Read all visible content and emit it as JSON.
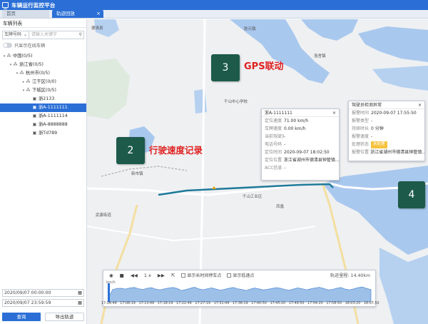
{
  "app": {
    "title": "车辆运行监控平台"
  },
  "tabs": [
    {
      "label": "首页"
    },
    {
      "label": "轨迹回放",
      "close": "×"
    }
  ],
  "sidebar": {
    "title": "车辆列表",
    "select_value": "车牌号码",
    "search_placeholder": "请输入关键字",
    "toggle_label": "只显示在线车辆",
    "tree": [
      {
        "label": "中国(0/5)",
        "level": 0,
        "type": "org",
        "expanded": true
      },
      {
        "label": "浙江省(0/5)",
        "level": 1,
        "type": "org",
        "expanded": true
      },
      {
        "label": "杭州市(0/5)",
        "level": 2,
        "type": "org",
        "expanded": true
      },
      {
        "label": "江干区(0/0)",
        "level": 3,
        "type": "org",
        "expanded": false
      },
      {
        "label": "下城区(0/5)",
        "level": 3,
        "type": "org",
        "expanded": true
      },
      {
        "label": "浙2133",
        "level": 4,
        "type": "car"
      },
      {
        "label": "浙A-1111111",
        "level": 4,
        "type": "car",
        "selected": true
      },
      {
        "label": "浙A-1111114",
        "level": 4,
        "type": "car"
      },
      {
        "label": "浙A-8888888",
        "level": 4,
        "type": "car"
      },
      {
        "label": "浙Td789",
        "level": 4,
        "type": "car"
      }
    ],
    "start_time": "2020/09/07 00:00:00",
    "end_time": "2020/09/07 23:59:59",
    "query_label": "查询",
    "export_label": "导出轨迹"
  },
  "map": {
    "labels": [
      {
        "text": "德清县"
      },
      {
        "text": "乾元镇"
      },
      {
        "text": "洛舍镇"
      },
      {
        "text": "千山中心学校"
      },
      {
        "text": "千山工业区"
      },
      {
        "text": "凤凰"
      },
      {
        "text": "武康街道"
      },
      {
        "text": "新市镇"
      }
    ]
  },
  "annotations": [
    {
      "number": "3",
      "text": "GPS联动"
    },
    {
      "number": "2",
      "text": "行驶速度记录"
    },
    {
      "number": "4"
    }
  ],
  "vehicle_popup": {
    "title": "浙A-1111111",
    "close": "×",
    "rows": [
      {
        "key": "定位速度",
        "value": "71.00 km/h"
      },
      {
        "key": "车牌速度",
        "value": "0.00 km/h"
      },
      {
        "key": "当前驾驶员",
        "value": "-"
      },
      {
        "key": "电话号码",
        "value": "-"
      },
      {
        "key": "定位时间",
        "value": "2020-09-07 18:02:50"
      },
      {
        "key": "定位位置",
        "value": "浙江省湖州市德清县钟管镇..."
      },
      {
        "key": "ACC信息",
        "value": "-"
      }
    ]
  },
  "alarm_popup": {
    "title": "驾驶员检测异常",
    "close": "×",
    "rows": [
      {
        "key": "报警时间",
        "value": "2020-09-07 17:55:50"
      },
      {
        "key": "报警类型",
        "value": "-"
      },
      {
        "key": "持续时长",
        "value": "0 分钟"
      },
      {
        "key": "报警速度",
        "value": "-"
      },
      {
        "key": "处理状态",
        "value": "未处理",
        "tag": true
      },
      {
        "key": "报警位置",
        "value": "浙江省湖州市德清县钟管镇..."
      }
    ]
  },
  "player": {
    "speed_value": "1",
    "speed_unit": "x",
    "checkbox1": "显示长时间停车点",
    "checkbox2": "显示低速点",
    "mileage": "轨迹里程: 14.40km",
    "unit": "km/h",
    "ticks": [
      "17:04:49",
      "17:08:19",
      "17:13:49",
      "17:18:19",
      "17:22:49",
      "17:27:19",
      "17:31:49",
      "17:36:19",
      "17:40:50",
      "17:45:20",
      "17:49:50",
      "17:54:20",
      "17:58:50",
      "18:03:20",
      "18:07:50"
    ],
    "speed_samples": [
      20,
      60,
      65,
      66,
      62,
      68,
      70,
      64,
      60,
      66,
      69,
      62,
      58,
      63,
      67,
      70,
      65,
      55,
      60,
      66,
      71,
      63,
      59,
      64,
      68,
      62,
      57,
      61,
      66,
      70,
      64,
      60,
      55,
      62,
      67,
      63,
      58,
      61,
      65,
      69,
      66,
      60,
      57,
      62,
      68,
      64,
      59,
      63,
      67,
      71,
      65,
      58,
      60,
      66,
      70,
      62,
      58,
      63,
      69,
      72,
      65,
      60
    ]
  }
}
